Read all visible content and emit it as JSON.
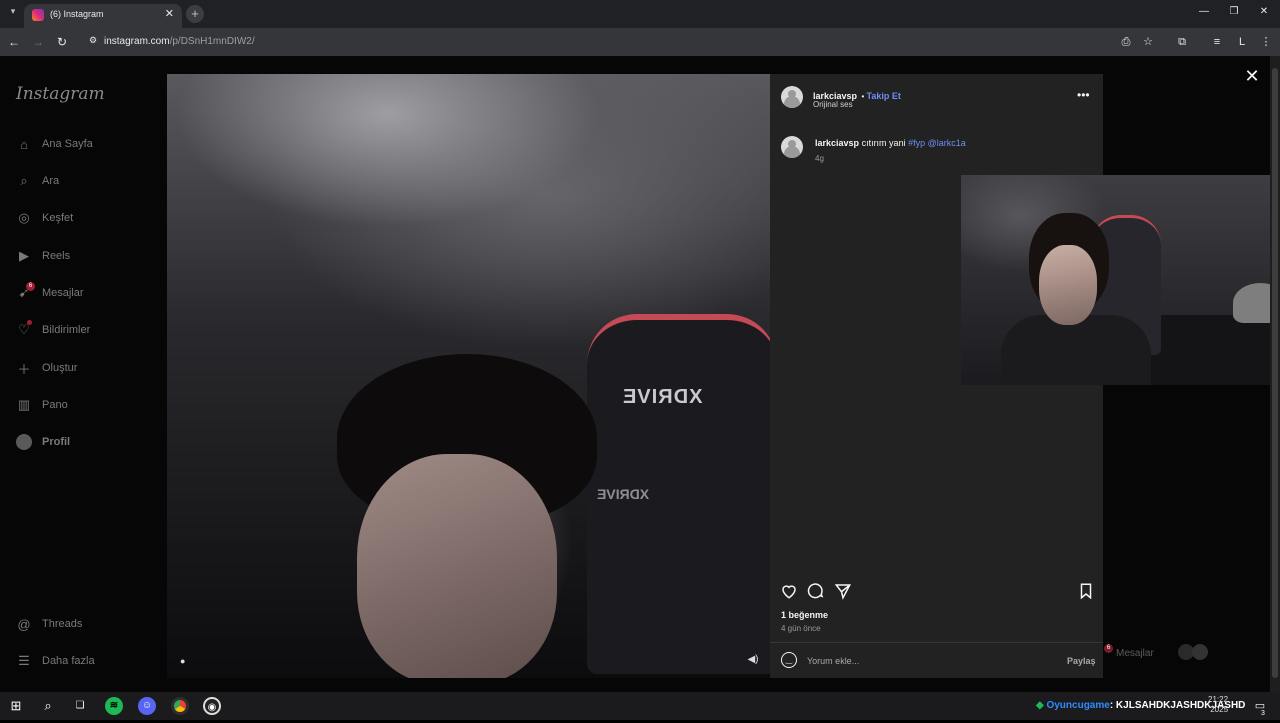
{
  "browser": {
    "tab_title": "(6) Instagram",
    "url_host": "instagram.com",
    "url_path": "/p/DSnH1mnDIW2/"
  },
  "sidebar": {
    "logo": "Instagram",
    "items": [
      {
        "label": "Ana Sayfa",
        "icon": "home-icon"
      },
      {
        "label": "Ara",
        "icon": "search-icon"
      },
      {
        "label": "Keşfet",
        "icon": "compass-icon"
      },
      {
        "label": "Reels",
        "icon": "reels-icon"
      },
      {
        "label": "Mesajlar",
        "icon": "messenger-icon",
        "badge": "6"
      },
      {
        "label": "Bildirimler",
        "icon": "heart-icon"
      },
      {
        "label": "Oluştur",
        "icon": "plus-icon"
      },
      {
        "label": "Pano",
        "icon": "dashboard-icon"
      },
      {
        "label": "Profil",
        "icon": "profile-avatar"
      }
    ],
    "bottom": [
      {
        "label": "Threads",
        "icon": "threads-icon"
      },
      {
        "label": "Daha fazla",
        "icon": "menu-icon"
      }
    ]
  },
  "post": {
    "username": "larkciavsp",
    "follow": "Takip Et",
    "audio": "Orijinal ses",
    "caption_text": "cıtırım yani",
    "hashtag": "#fyp",
    "mention": "@larkc1a",
    "caption_age": "4g",
    "likes": "1 beğenme",
    "time_ago": "4 gün önce",
    "comment_placeholder": "Yorum ekle...",
    "share": "Paylaş",
    "chair_brand": "XDRIVE"
  },
  "floating": {
    "messages": "Mesajlar",
    "badge": "6"
  },
  "taskbar": {
    "tray_prefix": "Oyuncugame",
    "tray_text": ": KJLSAHDKJASHDKJASHD",
    "time": "21:22",
    "date": "2025",
    "notif_count": "3"
  }
}
